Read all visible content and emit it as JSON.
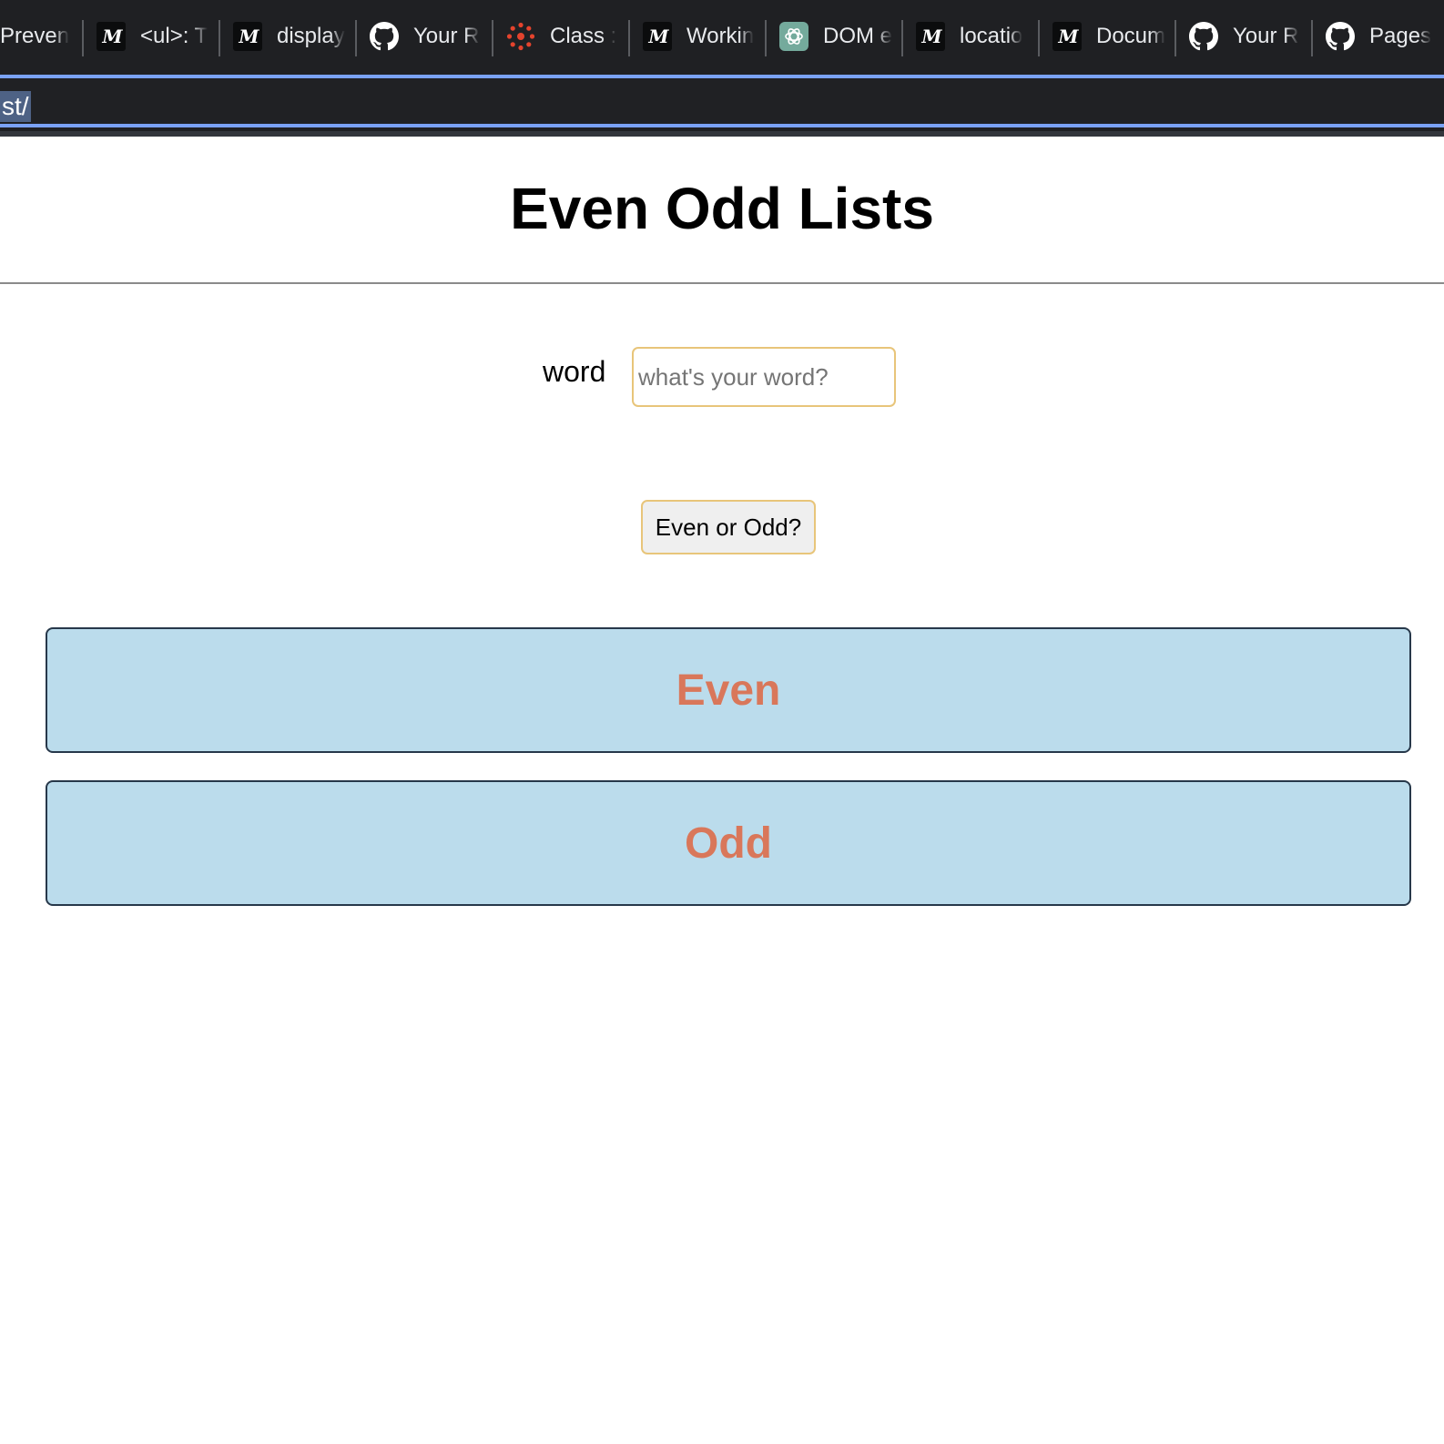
{
  "browser": {
    "tabs": [
      {
        "label": "Preven",
        "icon": "none"
      },
      {
        "label": "<ul>: T",
        "icon": "mdn-icon"
      },
      {
        "label": "display",
        "icon": "mdn-icon"
      },
      {
        "label": "Your R",
        "icon": "github-icon"
      },
      {
        "label": "Class :",
        "icon": "canvas-icon"
      },
      {
        "label": "Workin",
        "icon": "mdn-icon"
      },
      {
        "label": "DOM e",
        "icon": "chatgpt-icon"
      },
      {
        "label": "locatio",
        "icon": "mdn-icon"
      },
      {
        "label": "Docum",
        "icon": "mdn-icon"
      },
      {
        "label": "Your R",
        "icon": "github-icon"
      },
      {
        "label": "Pages",
        "icon": "github-icon"
      }
    ],
    "mdn_glyph": "M",
    "address": {
      "url_visible": "st/"
    }
  },
  "page": {
    "title": "Even Odd Lists",
    "form": {
      "word_label": "word",
      "word_value": "",
      "word_placeholder": "what's your word?",
      "button_label": "Even or Odd?"
    },
    "lists": {
      "even_heading": "Even",
      "odd_heading": "Odd"
    }
  },
  "colors": {
    "chrome_bg": "#1f2023",
    "focus_ring": "#7aa2f7",
    "input_border": "#e8c57a",
    "list_bg": "#bbdcec",
    "list_border": "#27384a",
    "list_heading": "#d9775a"
  }
}
